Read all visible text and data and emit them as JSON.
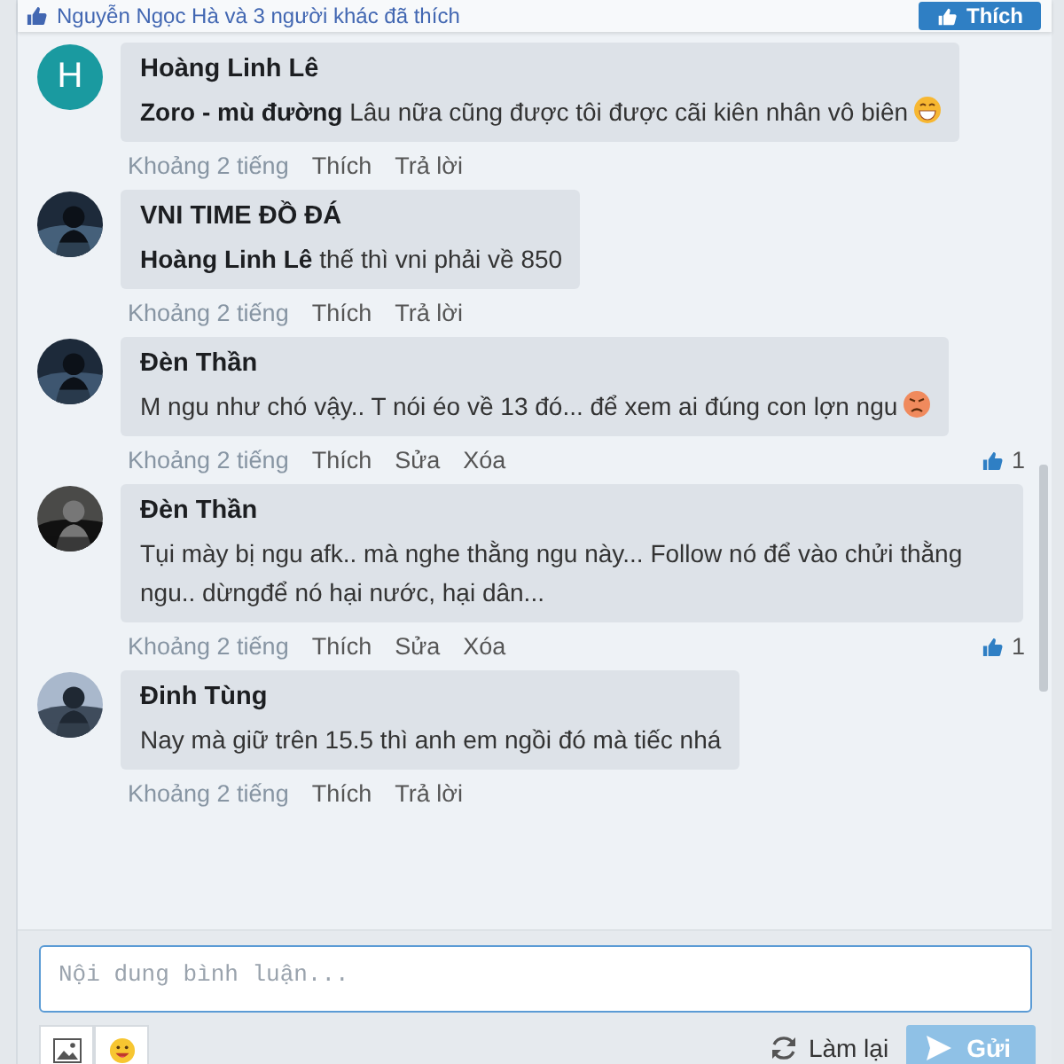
{
  "like_bar": {
    "text": "Nguyễn Ngọc Hà và 3 người khác đã thích",
    "button": "Thích"
  },
  "comments": [
    {
      "avatar": {
        "kind": "letter",
        "letter": "H",
        "color": "#1a9aa0"
      },
      "author": "Hoàng Linh Lê",
      "text": "**Zoro - mù đường** Lâu nữa cũng được tôi được cãi kiên nhân vô biên",
      "emoji": {
        "kind": "grin"
      },
      "meta": {
        "time": "Khoảng 2 tiếng",
        "actions": [
          "Thích",
          "Trả lời"
        ]
      }
    },
    {
      "author": "VNI TIME ĐỒ ĐÁ",
      "text": "**Hoàng Linh Lê** thế thì vni phải về 850",
      "meta": {
        "time": "Khoảng 2 tiếng",
        "actions": [
          "Thích",
          "Trả lời"
        ]
      }
    },
    {
      "author": "Đèn Thần",
      "text": "M ngu như chó vậy.. T nói éo về 13 đó... để xem ai đúng con lợn ngu",
      "emoji": {
        "kind": "angry"
      },
      "meta": {
        "time": "Khoảng 2 tiếng",
        "actions": [
          "Thích",
          "Sửa",
          "Xóa"
        ],
        "likes": "1"
      }
    },
    {
      "author": "Đèn Thần",
      "text": "Tụi mày bị ngu afk.. mà nghe thằng ngu này... Follow nó để vào chửi thằng ngu.. dừngđể nó hại nước, hại dân...",
      "meta": {
        "time": "Khoảng 2 tiếng",
        "actions": [
          "Thích",
          "Sửa",
          "Xóa"
        ],
        "likes": "1"
      }
    },
    {
      "author": "Đinh Tùng",
      "text": "Nay mà giữ trên 15.5 thì anh em ngồi đó mà tiếc nhá",
      "meta": {
        "time": "Khoảng 2 tiếng",
        "actions": [
          "Thích",
          "Trả lời"
        ]
      }
    }
  ],
  "composer": {
    "placeholder": "Nội dung bình luận...",
    "reset": "Làm lại",
    "send": "Gửi",
    "send_disabled": true
  }
}
